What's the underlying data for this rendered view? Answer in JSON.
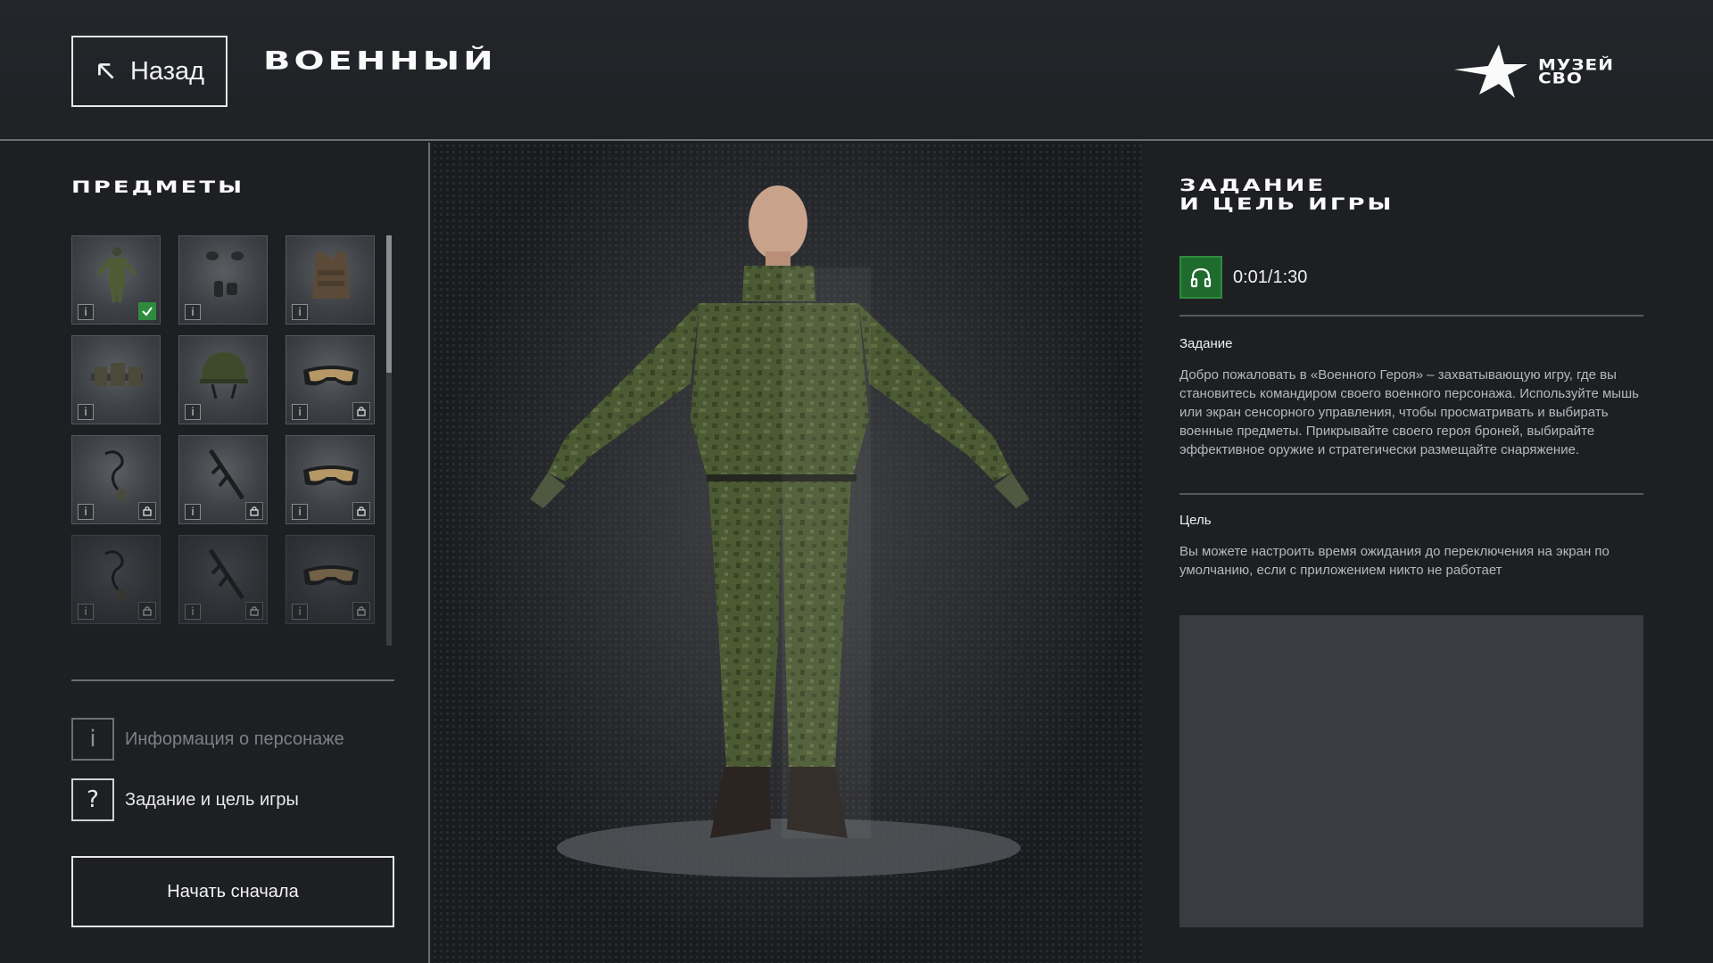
{
  "header": {
    "back_label": "Назад",
    "title": "ВОЕННЫЙ",
    "logo_line1": "МУЗЕЙ",
    "logo_line2": "СВО"
  },
  "left": {
    "heading": "ПРЕДМЕТЫ",
    "items": [
      {
        "name": "uniform",
        "icon": "uniform-icon",
        "selected": true,
        "locked": false
      },
      {
        "name": "gloves",
        "icon": "gloves-icon",
        "selected": false,
        "locked": false
      },
      {
        "name": "plate-carrier",
        "icon": "vest-icon",
        "selected": false,
        "locked": false
      },
      {
        "name": "belt-pouches",
        "icon": "pouches-icon",
        "selected": false,
        "locked": false
      },
      {
        "name": "helmet",
        "icon": "helmet-icon",
        "selected": false,
        "locked": false
      },
      {
        "name": "goggles",
        "icon": "goggles-icon",
        "selected": false,
        "locked": true
      },
      {
        "name": "headset",
        "icon": "headset-icon",
        "selected": false,
        "locked": true
      },
      {
        "name": "rifle",
        "icon": "rifle-icon",
        "selected": false,
        "locked": true
      },
      {
        "name": "goggles-2",
        "icon": "goggles-icon",
        "selected": false,
        "locked": true
      },
      {
        "name": "headset-2",
        "icon": "headset-icon",
        "selected": false,
        "locked": true
      },
      {
        "name": "rifle-2",
        "icon": "rifle-icon",
        "selected": false,
        "locked": true
      },
      {
        "name": "goggles-3",
        "icon": "goggles-icon",
        "selected": false,
        "locked": true
      }
    ],
    "info_label": "Информация о персонаже",
    "task_label": "Задание и цель игры",
    "restart_label": "Начать сначала"
  },
  "right": {
    "heading_line1": "ЗАДАНИЕ",
    "heading_line2": "И ЦЕЛЬ ИГРЫ",
    "audio_time": "0:01/1:30",
    "task_title": "Задание",
    "task_text": "Добро пожаловать в «Военного Героя» – захватывающую игру, где вы становитесь командиром своего военного персонажа. Используйте мышь или экран сенсорного управления, чтобы просматривать и выбирать военные предметы. Прикрывайте своего героя броней, выбирайте эффективное оружие и стратегически размещайте снаряжение.",
    "goal_title": "Цель",
    "goal_text": "Вы можете настроить время ожидания до переключения на экран по умолчанию, если с приложением никто не работает"
  },
  "colors": {
    "background": "#1d1f23",
    "accent_green": "#2e8b3e",
    "divider": "#6b6e73",
    "camo_dark": "#3f4a2c",
    "camo_light": "#5d6b3e"
  }
}
